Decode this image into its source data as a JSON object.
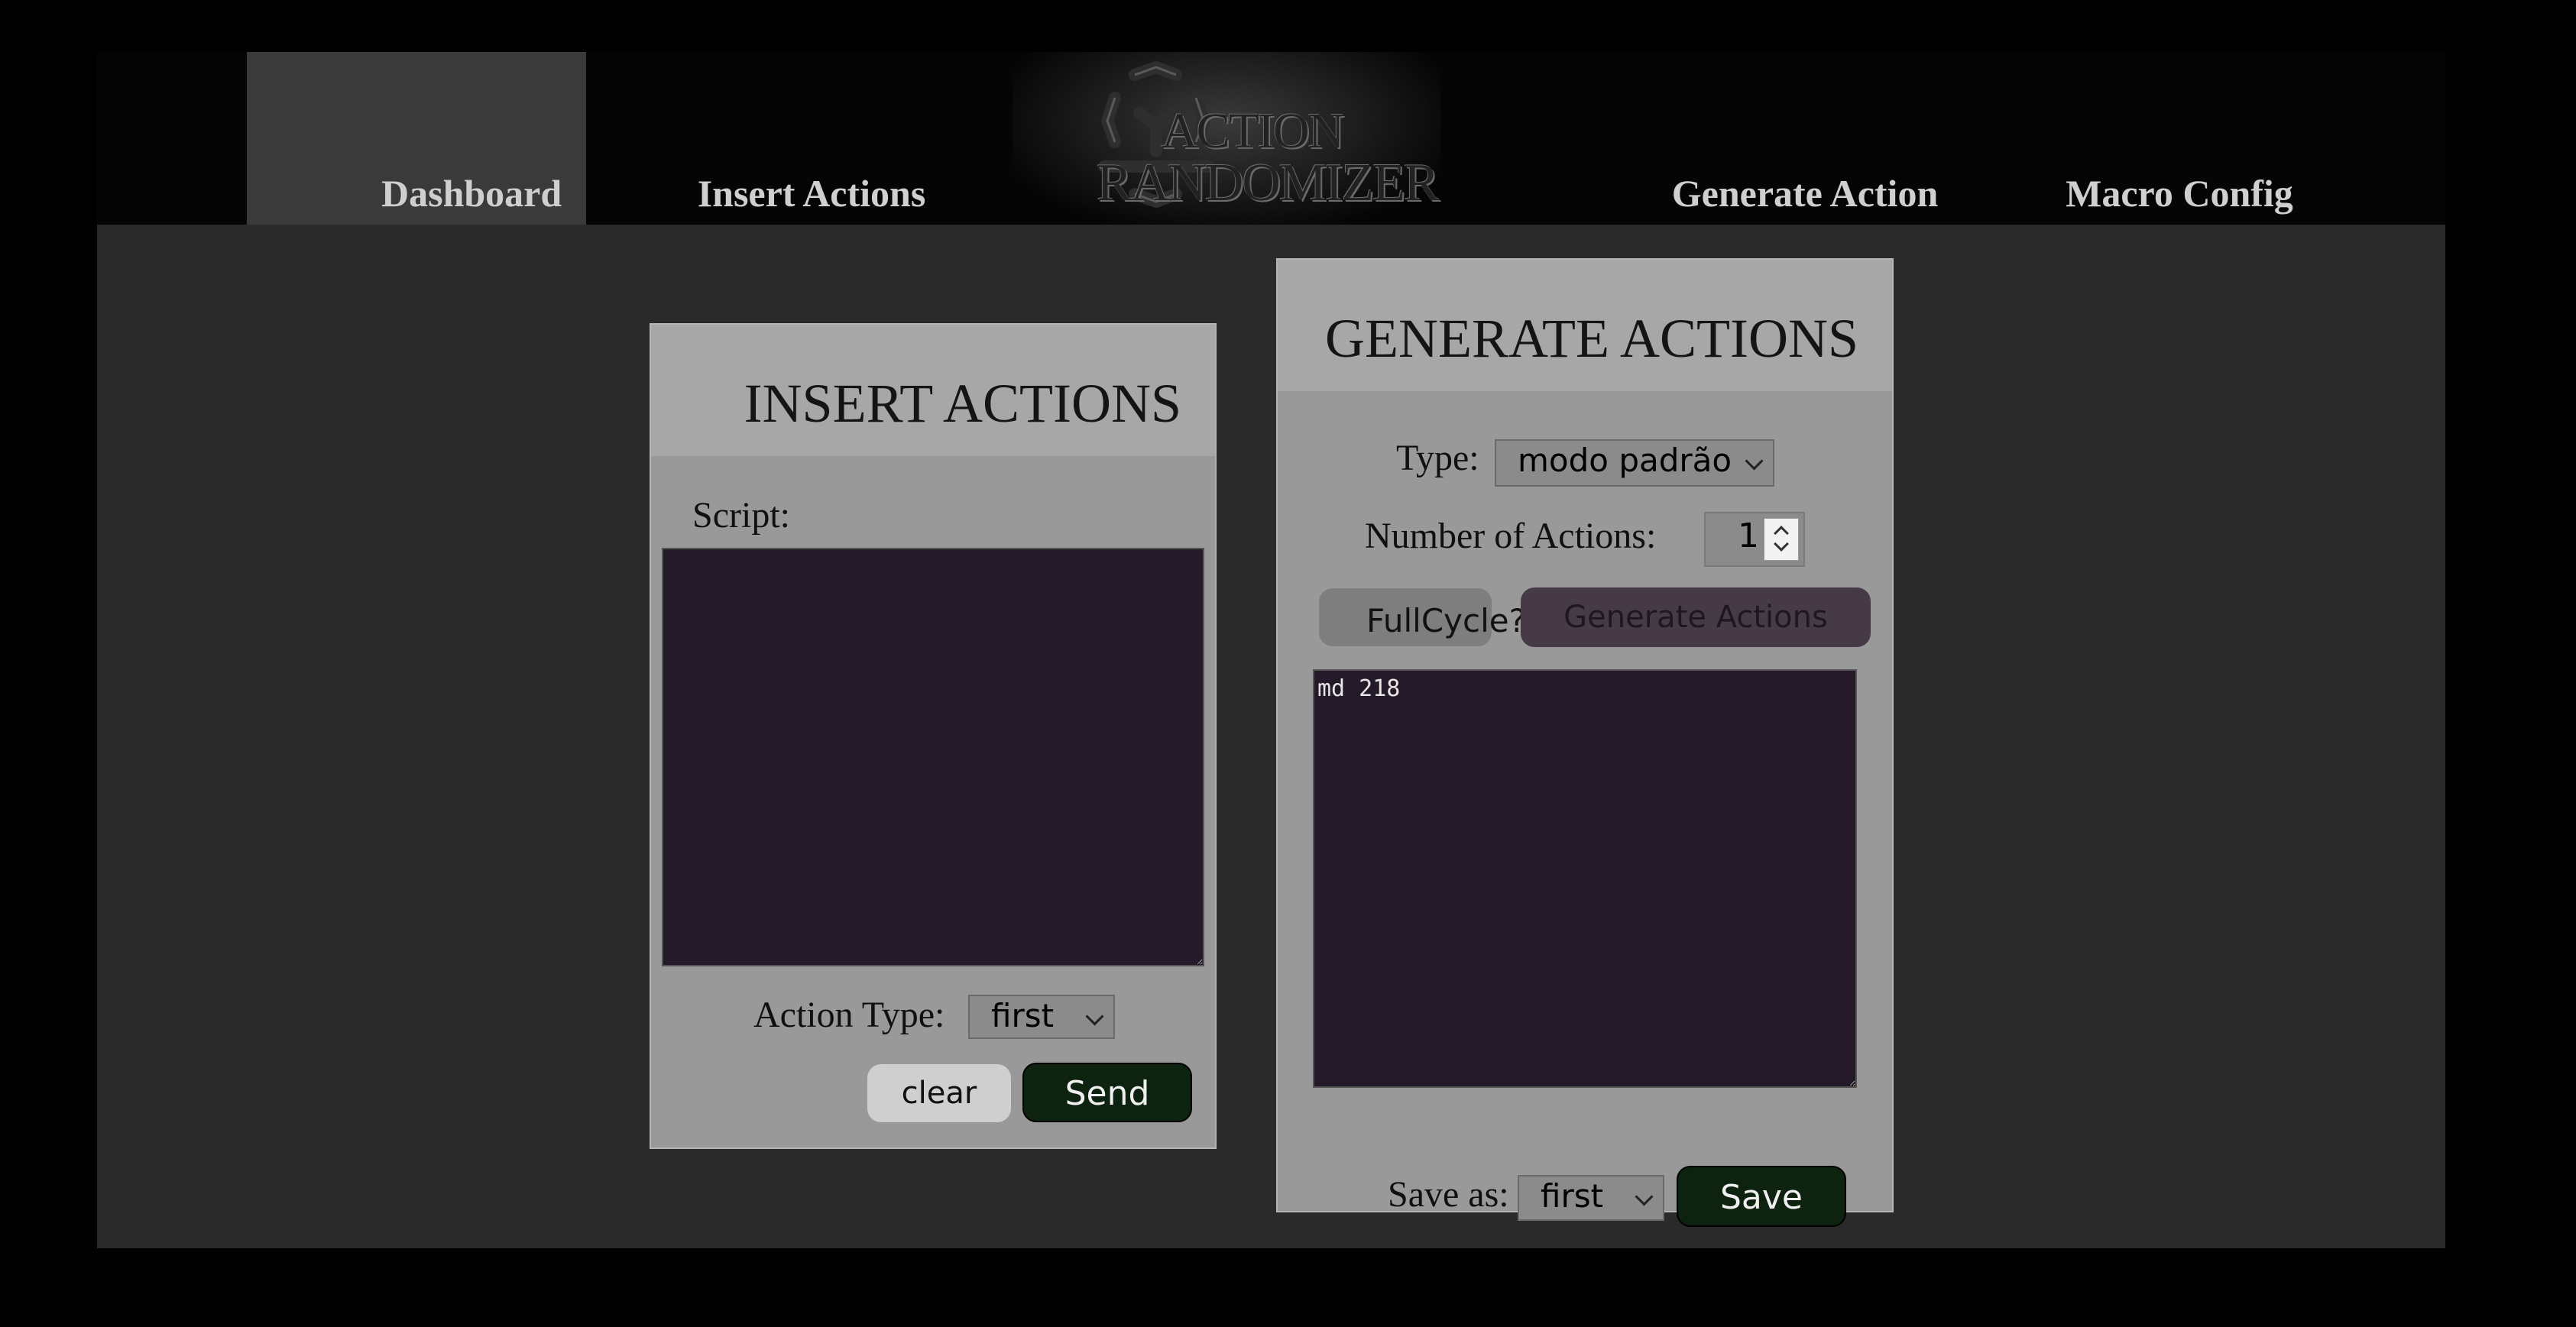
{
  "nav": {
    "items": [
      "Dashboard",
      "Insert Actions",
      "Generate Action",
      "Macro Config"
    ],
    "logo_line1": "ACTION",
    "logo_line2": "RANDOMIZER"
  },
  "insert": {
    "title": "INSERT ACTIONS",
    "script_label": "Script:",
    "script_value": "",
    "action_type_label": "Action Type:",
    "action_type_value": "first",
    "clear_label": "clear",
    "send_label": "Send"
  },
  "generate": {
    "title": "GENERATE ACTIONS",
    "type_label": "Type:",
    "type_value": "modo padrão",
    "number_label": "Number of Actions:",
    "number_value": "1",
    "fullcycle_label": "FullCycle?",
    "generate_label": "Generate Actions",
    "output_value": "md 218",
    "save_as_label": "Save as:",
    "save_as_value": "first",
    "save_label": "Save"
  },
  "colors": {
    "page_bg": "#000000",
    "content_bg": "#2a2a2a",
    "navbar_bg": "#050505",
    "active_nav_bg": "#3a3a3a",
    "card_bg": "#999999",
    "card_header_bg": "#a7a7a7",
    "textarea_bg": "#241a29",
    "send_bg": "#0d2310",
    "generate_bg": "#473a47"
  }
}
